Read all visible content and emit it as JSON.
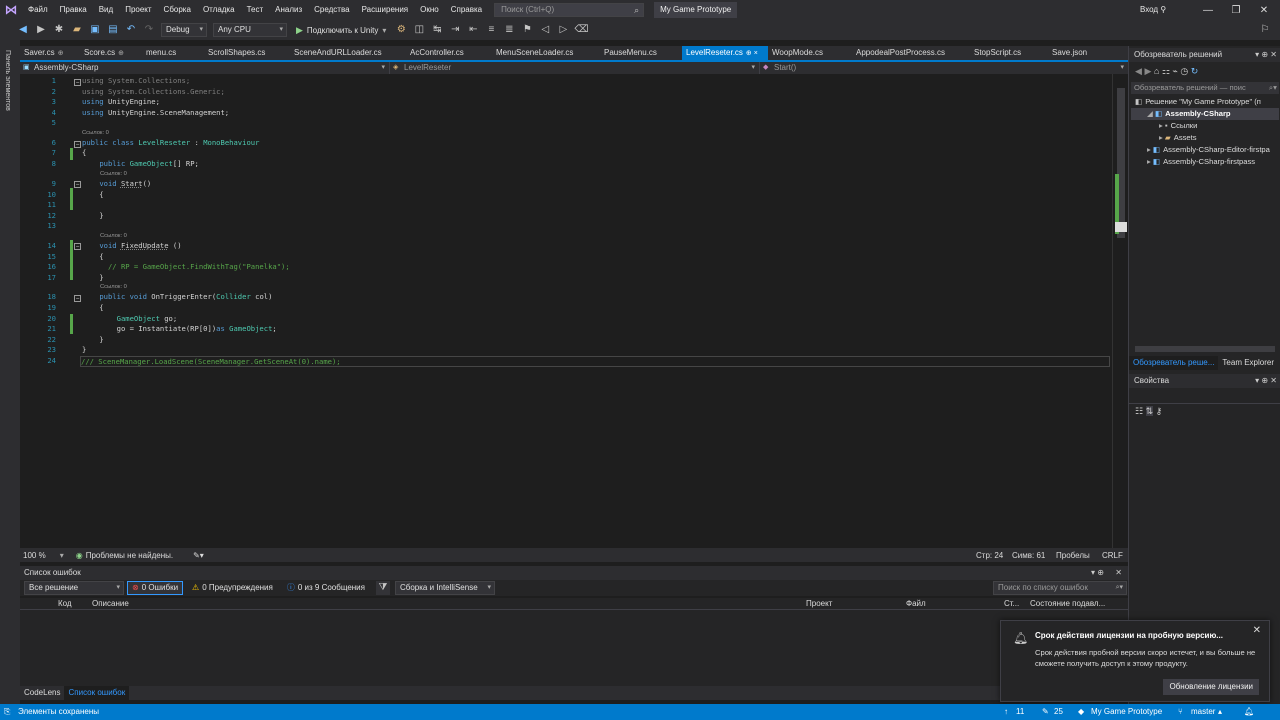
{
  "titlebar": {
    "menu": [
      "Файл",
      "Правка",
      "Вид",
      "Проект",
      "Сборка",
      "Отладка",
      "Тест",
      "Анализ",
      "Средства",
      "Расширения",
      "Окно",
      "Справка"
    ],
    "search_placeholder": "Поиск (Ctrl+Q)",
    "solution": "My Game Prototype",
    "login": "Вход"
  },
  "toolbar": {
    "config": "Debug",
    "platform": "Any CPU",
    "run_label": "Подключить к Unity"
  },
  "left_strip_label": "Панель элементов",
  "tabs": [
    {
      "label": "Saver.cs",
      "pin": "⊕"
    },
    {
      "label": "Score.cs",
      "pin": "⊕"
    },
    {
      "label": "menu.cs",
      "pin": ""
    },
    {
      "label": "ScrollShapes.cs",
      "pin": ""
    },
    {
      "label": "SceneAndURLLoader.cs",
      "pin": ""
    },
    {
      "label": "AcController.cs",
      "pin": ""
    },
    {
      "label": "MenuSceneLoader.cs",
      "pin": ""
    },
    {
      "label": "PauseMenu.cs",
      "pin": ""
    },
    {
      "label": "LevelReseter.cs",
      "pin": "⊕ ×",
      "active": true
    },
    {
      "label": "WoopMode.cs",
      "pin": ""
    },
    {
      "label": "AppodealPostProcess.cs",
      "pin": ""
    },
    {
      "label": "StopScript.cs",
      "pin": ""
    },
    {
      "label": "Save.json",
      "pin": ""
    }
  ],
  "navbar": {
    "project": "Assembly-CSharp",
    "class": "LevelReseter",
    "member": "Start()"
  },
  "code": {
    "ref_label": "Ссылок: 0",
    "lines": [
      "1",
      "2",
      "3",
      "4",
      "5",
      "6",
      "7",
      "8",
      "9",
      "10",
      "11",
      "12",
      "13",
      "14",
      "15",
      "16",
      "17",
      "18",
      "19",
      "20",
      "21",
      "22",
      "23",
      "24"
    ]
  },
  "editor_status": {
    "zoom": "100 %",
    "issues": "Проблемы не найдены.",
    "line": "Стр: 24",
    "col": "Симв: 61",
    "spaces": "Пробелы",
    "eol": "CRLF"
  },
  "error_list": {
    "title": "Список ошибок",
    "scope": "Все решение",
    "errors": "0 Ошибки",
    "warnings": "0 Предупреждения",
    "messages": "0 из 9 Сообщения",
    "build": "Сборка и IntelliSense",
    "search_placeholder": "Поиск по списку ошибок",
    "columns": [
      "Код",
      "Описание",
      "Проект",
      "Файл",
      "Ст...",
      "Состояние подавл..."
    ]
  },
  "bottom_tabs": [
    "CodeLens",
    "Список ошибок"
  ],
  "solution_explorer": {
    "title": "Обозреватель решений",
    "search_placeholder": "Обозреватель решений — поис",
    "items": [
      {
        "label": "Решение \"My Game Prototype\" (п",
        "indent": 0
      },
      {
        "label": "Assembly-CSharp",
        "indent": 1,
        "selected": true
      },
      {
        "label": "Ссылки",
        "indent": 2
      },
      {
        "label": "Assets",
        "indent": 2
      },
      {
        "label": "Assembly-CSharp-Editor-firstpa",
        "indent": 1
      },
      {
        "label": "Assembly-CSharp-firstpass",
        "indent": 1
      }
    ],
    "tabs": [
      "Обозреватель реше...",
      "Team Explorer"
    ]
  },
  "properties": {
    "title": "Свойства"
  },
  "toast": {
    "title": "Срок действия лицензии на пробную версию...",
    "message": "Срок действия пробной версии скоро истечет, и вы больше не сможете получить доступ к этому продукту.",
    "action": "Обновление лицензии"
  },
  "statusbar": {
    "saved": "Элементы сохранены",
    "up": "11",
    "edits": "25",
    "project": "My Game Prototype",
    "branch": "master"
  },
  "colors": {
    "accent": "#007acc",
    "bg": "#1e1e1e",
    "chrome": "#2d2d30"
  }
}
